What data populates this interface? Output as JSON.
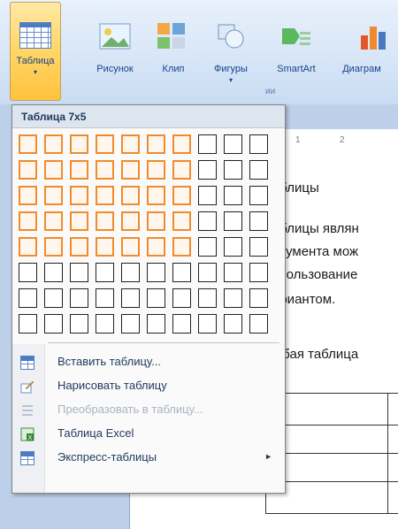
{
  "ribbon": {
    "buttons": [
      {
        "label": "Таблица",
        "icon": "table-icon",
        "active": true,
        "arrow": "▾"
      },
      {
        "label": "Рисунок",
        "icon": "picture-icon"
      },
      {
        "label": "Клип",
        "icon": "clipart-icon"
      },
      {
        "label": "Фигуры",
        "icon": "shapes-icon",
        "arrow": "▾"
      },
      {
        "label": "SmartArt",
        "icon": "smartart-icon"
      },
      {
        "label": "Диаграм",
        "icon": "chart-icon"
      }
    ],
    "group_label": "ии"
  },
  "menu": {
    "title": "Таблица 7x5",
    "grid": {
      "columns": 10,
      "rows": 8,
      "selected_columns": 7,
      "selected_rows": 5
    },
    "items": [
      {
        "label": "Вставить таблицу...",
        "icon": "insert-table-icon",
        "enabled": true
      },
      {
        "label": "Нарисовать таблицу",
        "icon": "draw-table-icon",
        "enabled": true
      },
      {
        "label": "Преобразовать в таблицу...",
        "icon": "convert-to-table-icon",
        "enabled": false
      },
      {
        "label": "Таблица Excel",
        "icon": "excel-table-icon",
        "enabled": true
      },
      {
        "label": "Экспресс-таблицы",
        "icon": "quick-tables-icon",
        "enabled": true,
        "submenu": "►"
      }
    ]
  },
  "ruler": {
    "marks": [
      "1",
      "2"
    ]
  },
  "document": {
    "lines": [
      "аблицы",
      "аблицы являн",
      "окумента мож",
      "спользование",
      "ариантом.",
      "юбая таблица"
    ]
  },
  "colors": {
    "accent_selection": "#f28b2b",
    "active_button": "#ffd86b",
    "menu_text": "#1e395b"
  }
}
